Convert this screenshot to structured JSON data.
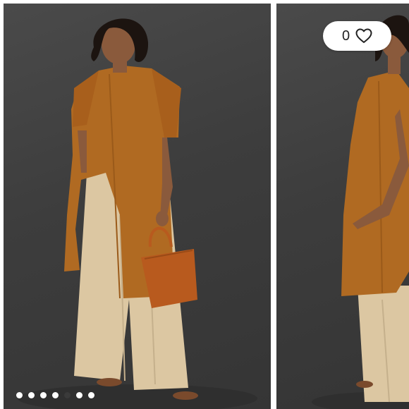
{
  "wishlist": {
    "count": "0",
    "icon": "heart-outline-icon"
  },
  "carousel": {
    "slides": [
      {
        "alt": ""
      },
      {
        "alt": ""
      }
    ],
    "dots": {
      "total": 7,
      "active_index": 4
    }
  },
  "colors": {
    "background": "#3d3d3d",
    "shirt": "#b06a22",
    "trousers": "#dcc7a2",
    "bag": "#b85a1e",
    "skin": "#8a5a3c",
    "hair": "#1c1410",
    "dot_active": "#3a3a3a",
    "dot_inactive": "#ffffff"
  }
}
